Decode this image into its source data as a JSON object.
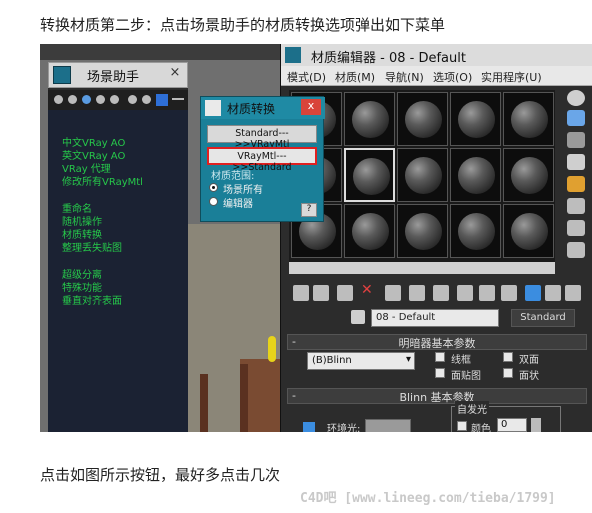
{
  "captions": {
    "top": "转换材质第二步：点击场景助手的材质转换选项弹出如下菜单",
    "bottom": "点击如图所示按钮，最好多点击几次",
    "watermark": "C4D吧 [www.lineeg.com/tieba/1799]"
  },
  "scene_assistant": {
    "title": "场景助手",
    "close": "×",
    "items_group1": [
      "中文VRay AO",
      "英文VRay AO",
      "VRay 代理",
      "修改所有VRayMtl"
    ],
    "items_group2": [
      "重命名",
      "随机操作",
      "材质转换",
      "整理丢失贴图"
    ],
    "items_group3": [
      "超级分离",
      "特殊功能",
      "垂直对齐表面"
    ]
  },
  "material_editor": {
    "title": "材质编辑器 - 08 - Default",
    "menus": [
      "模式(D)",
      "材质(M)",
      "导航(N)",
      "选项(O)",
      "实用程序(U)"
    ],
    "material_name": "08 - Default",
    "type_button": "Standard",
    "rollout1": "明暗器基本参数",
    "shader": "(B)Blinn",
    "checkboxes": [
      "线框",
      "双面",
      "面贴图",
      "面状"
    ],
    "rollout2": "Blinn 基本参数",
    "self_illum": "自发光",
    "ambient": "环境光:",
    "color": "颜色",
    "color_value": "0"
  },
  "convert_dialog": {
    "title": "材质转换",
    "close": "x",
    "btn1": "Standard--->>VRayMtl",
    "btn2": "VRayMtl--->>Standard",
    "range_label": "材质范围:",
    "opt_all": "场景所有",
    "opt_editor": "编辑器",
    "help": "?"
  },
  "colors": {
    "accent_green": "#26c84a",
    "dialog_teal": "#1a7f98",
    "highlight_red": "#e02020"
  }
}
